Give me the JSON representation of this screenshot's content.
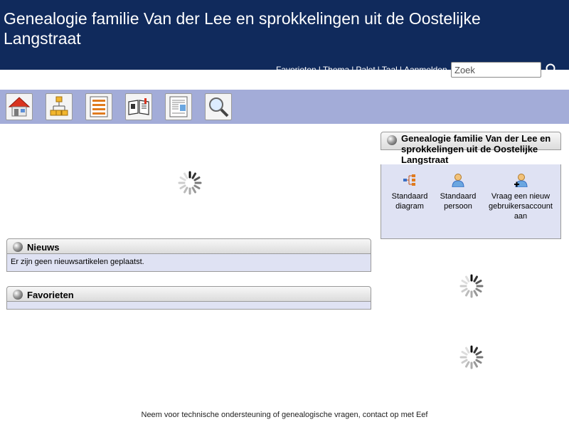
{
  "header": {
    "title": "Genealogie familie Van der Lee en sprokkelingen uit de Oostelijke Langstraat",
    "topmenu": [
      "Favorieten",
      "Thema",
      "Palet",
      "Taal",
      "Aanmelden"
    ],
    "separator": "|",
    "search": {
      "placeholder": "Zoek"
    }
  },
  "iconbar": {
    "items": [
      "home-icon",
      "pedigree-icon",
      "list-icon",
      "book-icon",
      "report-icon",
      "search-icon"
    ]
  },
  "news": {
    "title": "Nieuws",
    "body": "Er zijn geen nieuwsartikelen geplaatst."
  },
  "favorites": {
    "title": "Favorieten"
  },
  "side": {
    "title": "Genealogie familie Van der Lee en sprokkelingen uit de Oostelijke Langstraat",
    "links": [
      {
        "label": "Standaard diagram",
        "icon": "chart-icon"
      },
      {
        "label": "Standaard persoon",
        "icon": "person-icon"
      },
      {
        "label": "Vraag een nieuw gebruikersaccount aan",
        "icon": "add-person-icon"
      }
    ]
  },
  "footer": {
    "text": "Neem voor technische ondersteuning of genealogische vragen, contact op met Eef"
  },
  "colors": {
    "header_bg": "#102a5c",
    "iconbar_bg": "#a3acd8",
    "block_body_bg": "#dfe2f3"
  }
}
